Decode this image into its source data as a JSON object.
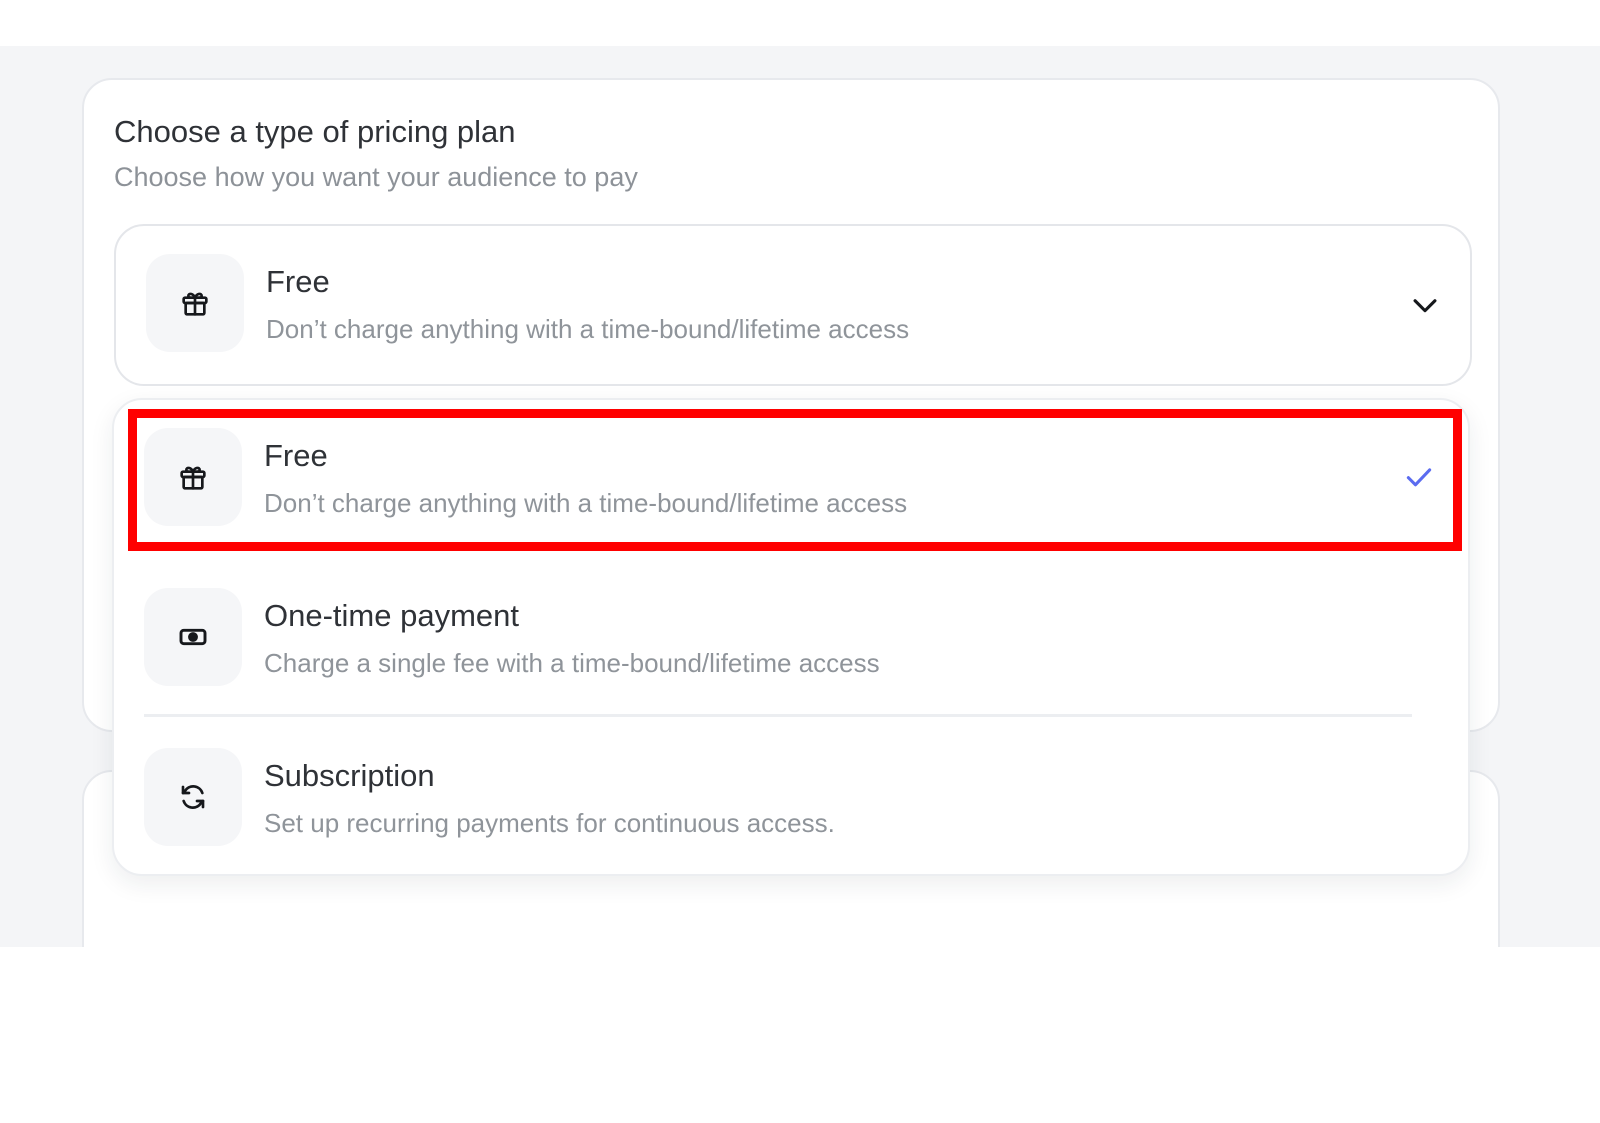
{
  "card": {
    "title": "Choose a type of pricing plan",
    "subtitle": "Choose how you want your audience to pay"
  },
  "select": {
    "selected_label": "Free",
    "selected_description": "Don’t charge anything with a time-bound/lifetime access",
    "icon": "gift-icon",
    "toggle_icon": "chevron-down-icon"
  },
  "dropdown": {
    "options": [
      {
        "label": "Free",
        "description": "Don’t charge anything with a time-bound/lifetime access",
        "icon": "gift-icon",
        "selected": true
      },
      {
        "label": "One-time payment",
        "description": "Charge a single fee with a time-bound/lifetime access",
        "icon": "banknote-icon",
        "selected": false
      },
      {
        "label": "Subscription",
        "description": "Set up recurring payments for continuous access.",
        "icon": "refresh-icon",
        "selected": false
      }
    ]
  },
  "colors": {
    "accent": "#5b6cf0",
    "highlight": "#ff0000",
    "page_background": "#f4f5f7"
  }
}
